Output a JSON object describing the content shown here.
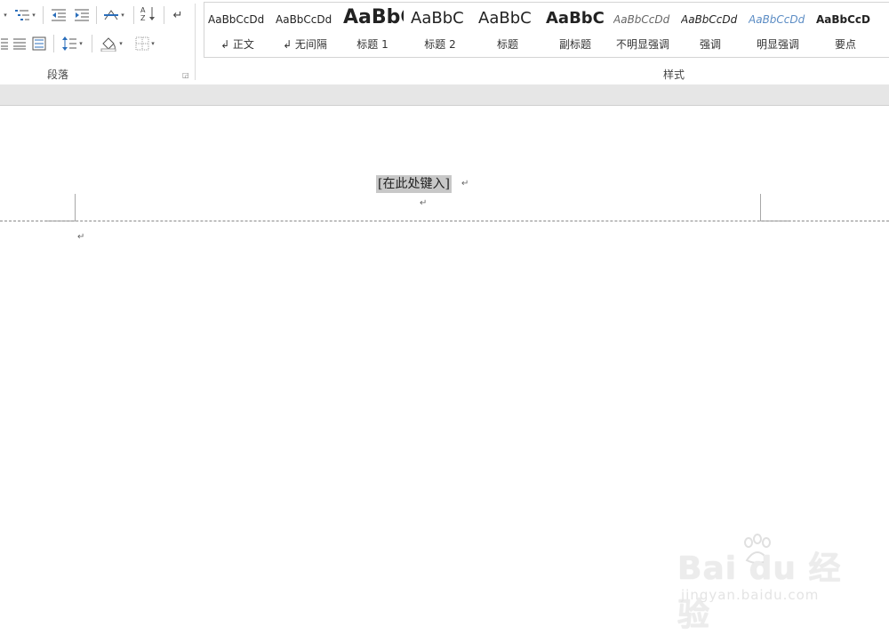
{
  "ribbon": {
    "paragraph_group_label": "段落",
    "styles_group_label": "样式",
    "paragraph_tools": {
      "sort_icon_text": "A↓Z",
      "show_marks_glyph": "↵"
    },
    "styles": [
      {
        "preview": "AaBbCcDd",
        "label": "↲ 正文"
      },
      {
        "preview": "AaBbCcDd",
        "label": "↲ 无间隔"
      },
      {
        "preview": "AaBbC",
        "label": "标题 1"
      },
      {
        "preview": "AaBbC",
        "label": "标题 2"
      },
      {
        "preview": "AaBbC",
        "label": "标题"
      },
      {
        "preview": "AaBbC",
        "label": "副标题"
      },
      {
        "preview": "AaBbCcDd",
        "label": "不明显强调"
      },
      {
        "preview": "AaBbCcDd",
        "label": "强调"
      },
      {
        "preview": "AaBbCcDd",
        "label": "明显强调"
      },
      {
        "preview": "AaBbCcD",
        "label": "要点"
      }
    ]
  },
  "document": {
    "header_placeholder": "[在此处键入]",
    "paragraph_mark": "↵"
  },
  "watermark": {
    "main": "Bai du 经验",
    "sub": "jingyan.baidu.com"
  },
  "colors": {
    "ribbon_bg": "#ffffff",
    "band_bg": "#e6e6e6",
    "field_highlight": "#c8c8c8"
  }
}
